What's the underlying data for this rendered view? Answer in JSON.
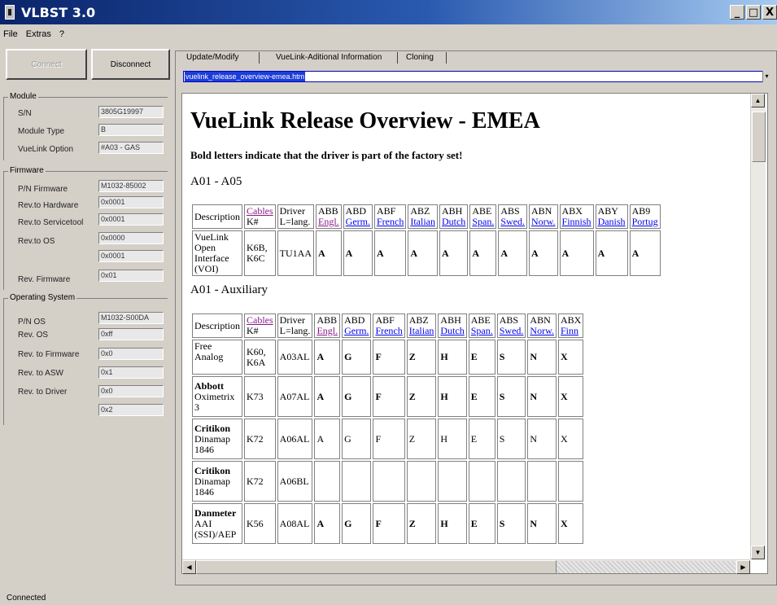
{
  "window": {
    "title": "VLBST 3.0",
    "buttons": [
      "_",
      "□",
      "X"
    ]
  },
  "menu": [
    "File",
    "Extras",
    "?"
  ],
  "connection": {
    "connect_label": "Connect",
    "disconnect_label": "Disconnect"
  },
  "module": {
    "title": "Module",
    "sn_label": "S/N",
    "sn_value": "3805G19997",
    "type_label": "Module Type",
    "type_value": "B",
    "option_label": "VueLink Option",
    "option_value": "#A03 - GAS"
  },
  "firmware": {
    "title": "Firmware",
    "pn_label": "P/N Firmware",
    "pn_value": "M1032-85002",
    "rev_hw_label": "Rev.to Hardware",
    "rev_hw_value": "0x0001",
    "rev_st_label": "Rev.to Servicetool",
    "rev_st_value": "0x0001",
    "rev_os_label": "Rev.to OS",
    "rev_os_value": "0x0000",
    "rev_os_value2": "0x0001",
    "rev_fw_label": "Rev. Firmware",
    "rev_fw_value": "0x01"
  },
  "os": {
    "title": "Operating System",
    "pn_label": "P/N OS",
    "pn_value": "M1032-S00DA",
    "rev_label": "Rev. OS",
    "rev_value": "0xff",
    "rev_fw_label": "Rev. to Firmware",
    "rev_fw_value": "0x0",
    "rev_asw_label": "Rev. to ASW",
    "rev_asw_value": "0x1",
    "rev_drv_label": "Rev. to Driver",
    "rev_drv_value": "0x0",
    "extra_value": "0x2"
  },
  "status": "Connected",
  "tabs": [
    "Update/Modify",
    "VueLink-Aditional Information",
    "Cloning"
  ],
  "url": "vuelink_release_overview-emea.htm",
  "doc": {
    "title": "VueLink Release Overview - EMEA",
    "note": "Bold letters indicate that the driver is part of the factory set!",
    "section1": "A01 - A05",
    "section2": "A01 - Auxiliary",
    "t1_header": [
      "Description",
      "Cables",
      "K#",
      "Driver",
      "L=lang.",
      "ABB",
      "Engl.",
      "ABD",
      "Germ.",
      "ABF",
      "French",
      "ABZ",
      "Italian",
      "ABH",
      "Dutch",
      "ABE",
      "Span.",
      "ABS",
      "Swed.",
      "ABN",
      "Norw.",
      "ABX",
      "Finnish",
      "ABY",
      "Danish",
      "AB9",
      "Portug"
    ],
    "t1_row": [
      "VueLink Open Interface (VOI)",
      "K6B, K6C",
      "TU1AA",
      "A",
      "A",
      "A",
      "A",
      "A",
      "A",
      "A",
      "A",
      "A",
      "A",
      "A"
    ],
    "t2_header": [
      "Description",
      "Cables",
      "K#",
      "Driver",
      "L=lang.",
      "ABB",
      "Engl.",
      "ABD",
      "Germ.",
      "ABF",
      "French",
      "ABZ",
      "Italian",
      "ABH",
      "Dutch",
      "ABE",
      "Span.",
      "ABS",
      "Swed.",
      "ABN",
      "Norw.",
      "ABX",
      "Finn"
    ],
    "t2_rows": [
      {
        "d1": "Free",
        "d2": "Analog",
        "d3": "",
        "d4": "",
        "k": "K60, K6A",
        "drv": "A03AL",
        "v": [
          "A",
          "G",
          "F",
          "Z",
          "H",
          "E",
          "S",
          "N",
          "X"
        ]
      },
      {
        "d1": "Abbott",
        "d2": "Oximetrix",
        "d3": "3",
        "d4": "",
        "k": "K73",
        "drv": "A07AL",
        "v": [
          "A",
          "G",
          "F",
          "Z",
          "H",
          "E",
          "S",
          "N",
          "X"
        ]
      },
      {
        "d1": "Critikon",
        "d2": "Dinamap",
        "d3": "1846",
        "d4": "",
        "k": "K72",
        "drv": "A06AL",
        "v": [
          "A",
          "G",
          "F",
          "Z",
          "H",
          "E",
          "S",
          "N",
          "X"
        ]
      },
      {
        "d1": "Critikon",
        "d2": "Dinamap",
        "d3": "1846",
        "d4": "",
        "k": "K72",
        "drv": "A06BL",
        "v": [
          "",
          "",
          "",
          "",
          "",
          "",
          "",
          "",
          ""
        ]
      },
      {
        "d1": "Danmeter",
        "d2": "AAI",
        "d3": "(SSI)/AEP",
        "d4": "",
        "k": "K56",
        "drv": "A08AL",
        "v": [
          "A",
          "G",
          "F",
          "Z",
          "H",
          "E",
          "S",
          "N",
          "X"
        ]
      }
    ]
  }
}
